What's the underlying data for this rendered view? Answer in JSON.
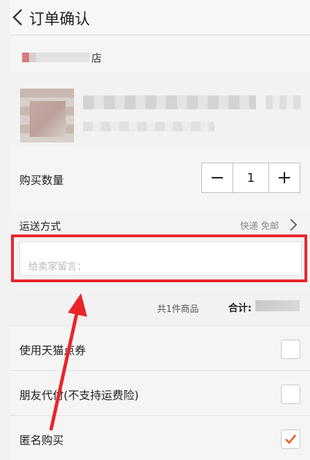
{
  "header": {
    "title": "订单确认"
  },
  "shop": {
    "name_suffix": "店"
  },
  "quantity": {
    "label": "购买数量",
    "minus": "−",
    "plus": "+",
    "value": "1"
  },
  "shipping": {
    "label": "运送方式",
    "value": "快递 免邮"
  },
  "message": {
    "placeholder": "给卖家留言："
  },
  "summary": {
    "count_text": "共1件商品",
    "total_label": "合计:"
  },
  "options": [
    {
      "label": "使用天猫点券",
      "checked": false
    },
    {
      "label": "朋友代付(不支持运费险)",
      "checked": false
    },
    {
      "label": "匿名购买",
      "checked": true
    }
  ],
  "colors": {
    "highlight": "#e8262a",
    "check": "#f05a23"
  }
}
